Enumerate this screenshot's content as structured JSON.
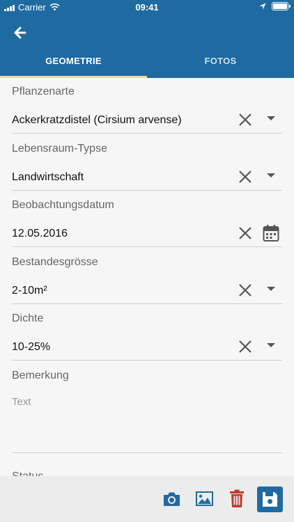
{
  "status_bar": {
    "carrier": "Carrier",
    "time": "09:41"
  },
  "tabs": [
    {
      "label": "GEOMETRIE",
      "active": true
    },
    {
      "label": "FOTOS",
      "active": false
    }
  ],
  "fields": [
    {
      "label": "Pflanzenarte",
      "value": "Ackerkratzdistel (Cirsium arvense)",
      "control": "dropdown"
    },
    {
      "label": "Lebensraum-Typse",
      "value": "Landwirtschaft",
      "control": "dropdown"
    },
    {
      "label": "Beobachtungsdatum",
      "value": "12.05.2016",
      "control": "calendar"
    },
    {
      "label": "Bestandesgrösse",
      "value": "2-10m²",
      "control": "dropdown"
    },
    {
      "label": "Dichte",
      "value": "10-25%",
      "control": "dropdown"
    }
  ],
  "remark": {
    "label": "Bemerkung",
    "placeholder": "Text"
  },
  "status": {
    "label": "Status"
  },
  "colors": {
    "primary": "#1f6aa0",
    "tab_indicator": "#f0d99a",
    "delete": "#c0392b"
  },
  "toolbar": {
    "icons": [
      "camera-icon",
      "image-icon",
      "trash-icon",
      "save-icon"
    ]
  }
}
